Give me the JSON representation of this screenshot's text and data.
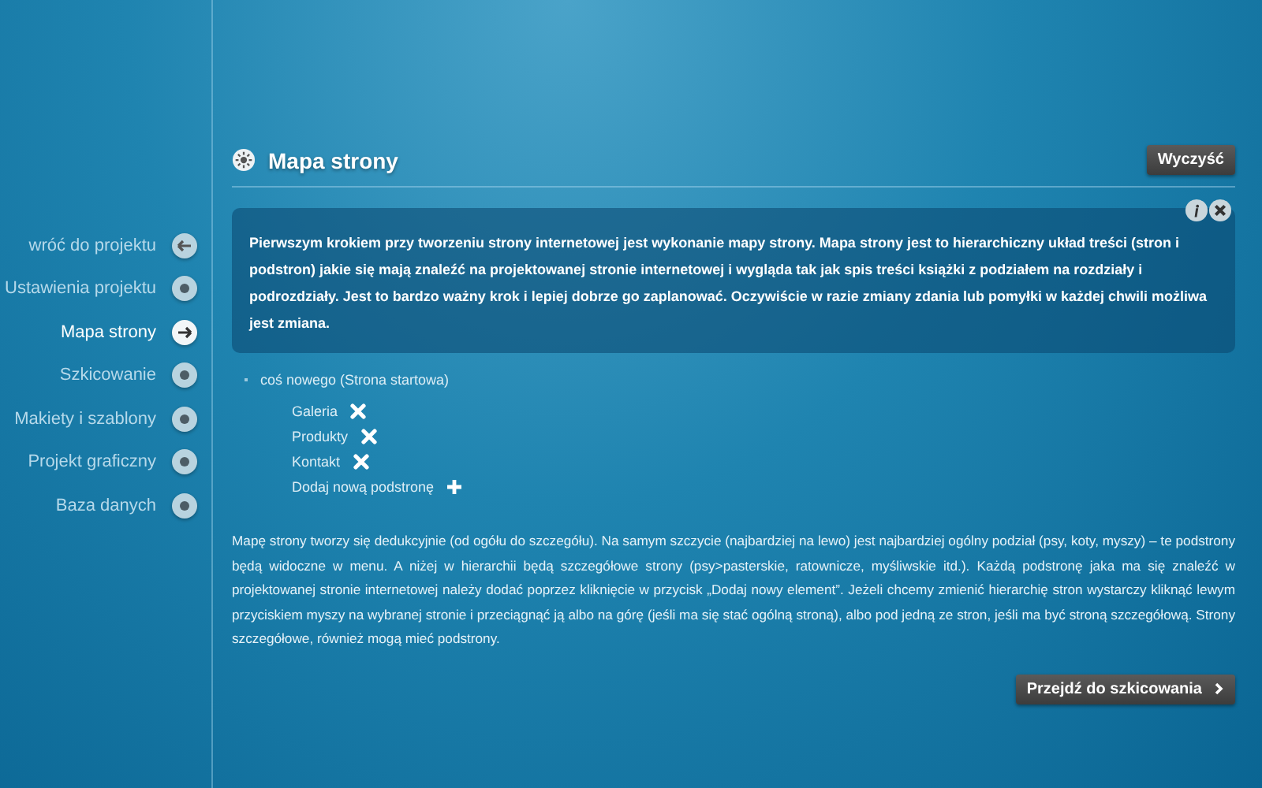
{
  "sidebar": {
    "items": [
      {
        "label": "wróć do projektu",
        "kind": "back",
        "selected": false
      },
      {
        "label": "Ustawienia projektu",
        "kind": "step",
        "selected": false
      },
      {
        "label": "Mapa strony",
        "kind": "step",
        "selected": true
      },
      {
        "label": "Szkicowanie",
        "kind": "step",
        "selected": false
      },
      {
        "label": "Makiety i szablony",
        "kind": "step",
        "selected": false
      },
      {
        "label": "Projekt graficzny",
        "kind": "step",
        "selected": false
      },
      {
        "label": "Baza danych",
        "kind": "step",
        "selected": false
      }
    ]
  },
  "header": {
    "title": "Mapa strony",
    "button": "Wyczyść"
  },
  "info_box": {
    "text": "Pierwszym krokiem przy tworzeniu strony internetowej jest wykonanie mapy strony. Mapa strony jest to hierarchiczny układ treści (stron i podstron) jakie się mają znaleźć na projektowanej stronie internetowej i wygląda tak jak spis treści książki z podziałem na rozdziały i podrozdziały. Jest to bardzo ważny krok i lepiej dobrze go zaplanować. Oczywiście w razie zmiany zdania lub pomyłki w każdej chwili możliwa jest zmiana."
  },
  "sitemap": {
    "root": "coś nowego (Strona startowa)",
    "children": [
      {
        "label": "Galeria"
      },
      {
        "label": "Produkty"
      },
      {
        "label": "Kontakt"
      }
    ],
    "add_label": "Dodaj nową podstronę"
  },
  "description": "Mapę strony tworzy się dedukcyjnie (od ogółu do szczegółu). Na samym szczycie (najbardziej na lewo) jest najbardziej ogólny podział (psy, koty, myszy) – te podstrony będą widoczne w menu. A niżej w hierarchii będą szczegółowe strony (psy>pasterskie, ratownicze, myśliwskie itd.). Każdą podstronę jaka ma się znaleźć w projektowanej stronie internetowej należy dodać poprzez kliknięcie w przycisk „Dodaj nowy element”. Jeżeli chcemy zmienić hierarchię stron wystarczy kliknąć lewym przyciskiem myszy na wybranej stronie i przeciągnąć ją albo na górę (jeśli ma się stać ogólną stroną), albo pod jedną ze stron, jeśli ma być stroną szczegółową. Strony szczegółowe, również mogą mieć podstrony.",
  "next_button": "Przejdź do szkicowania"
}
